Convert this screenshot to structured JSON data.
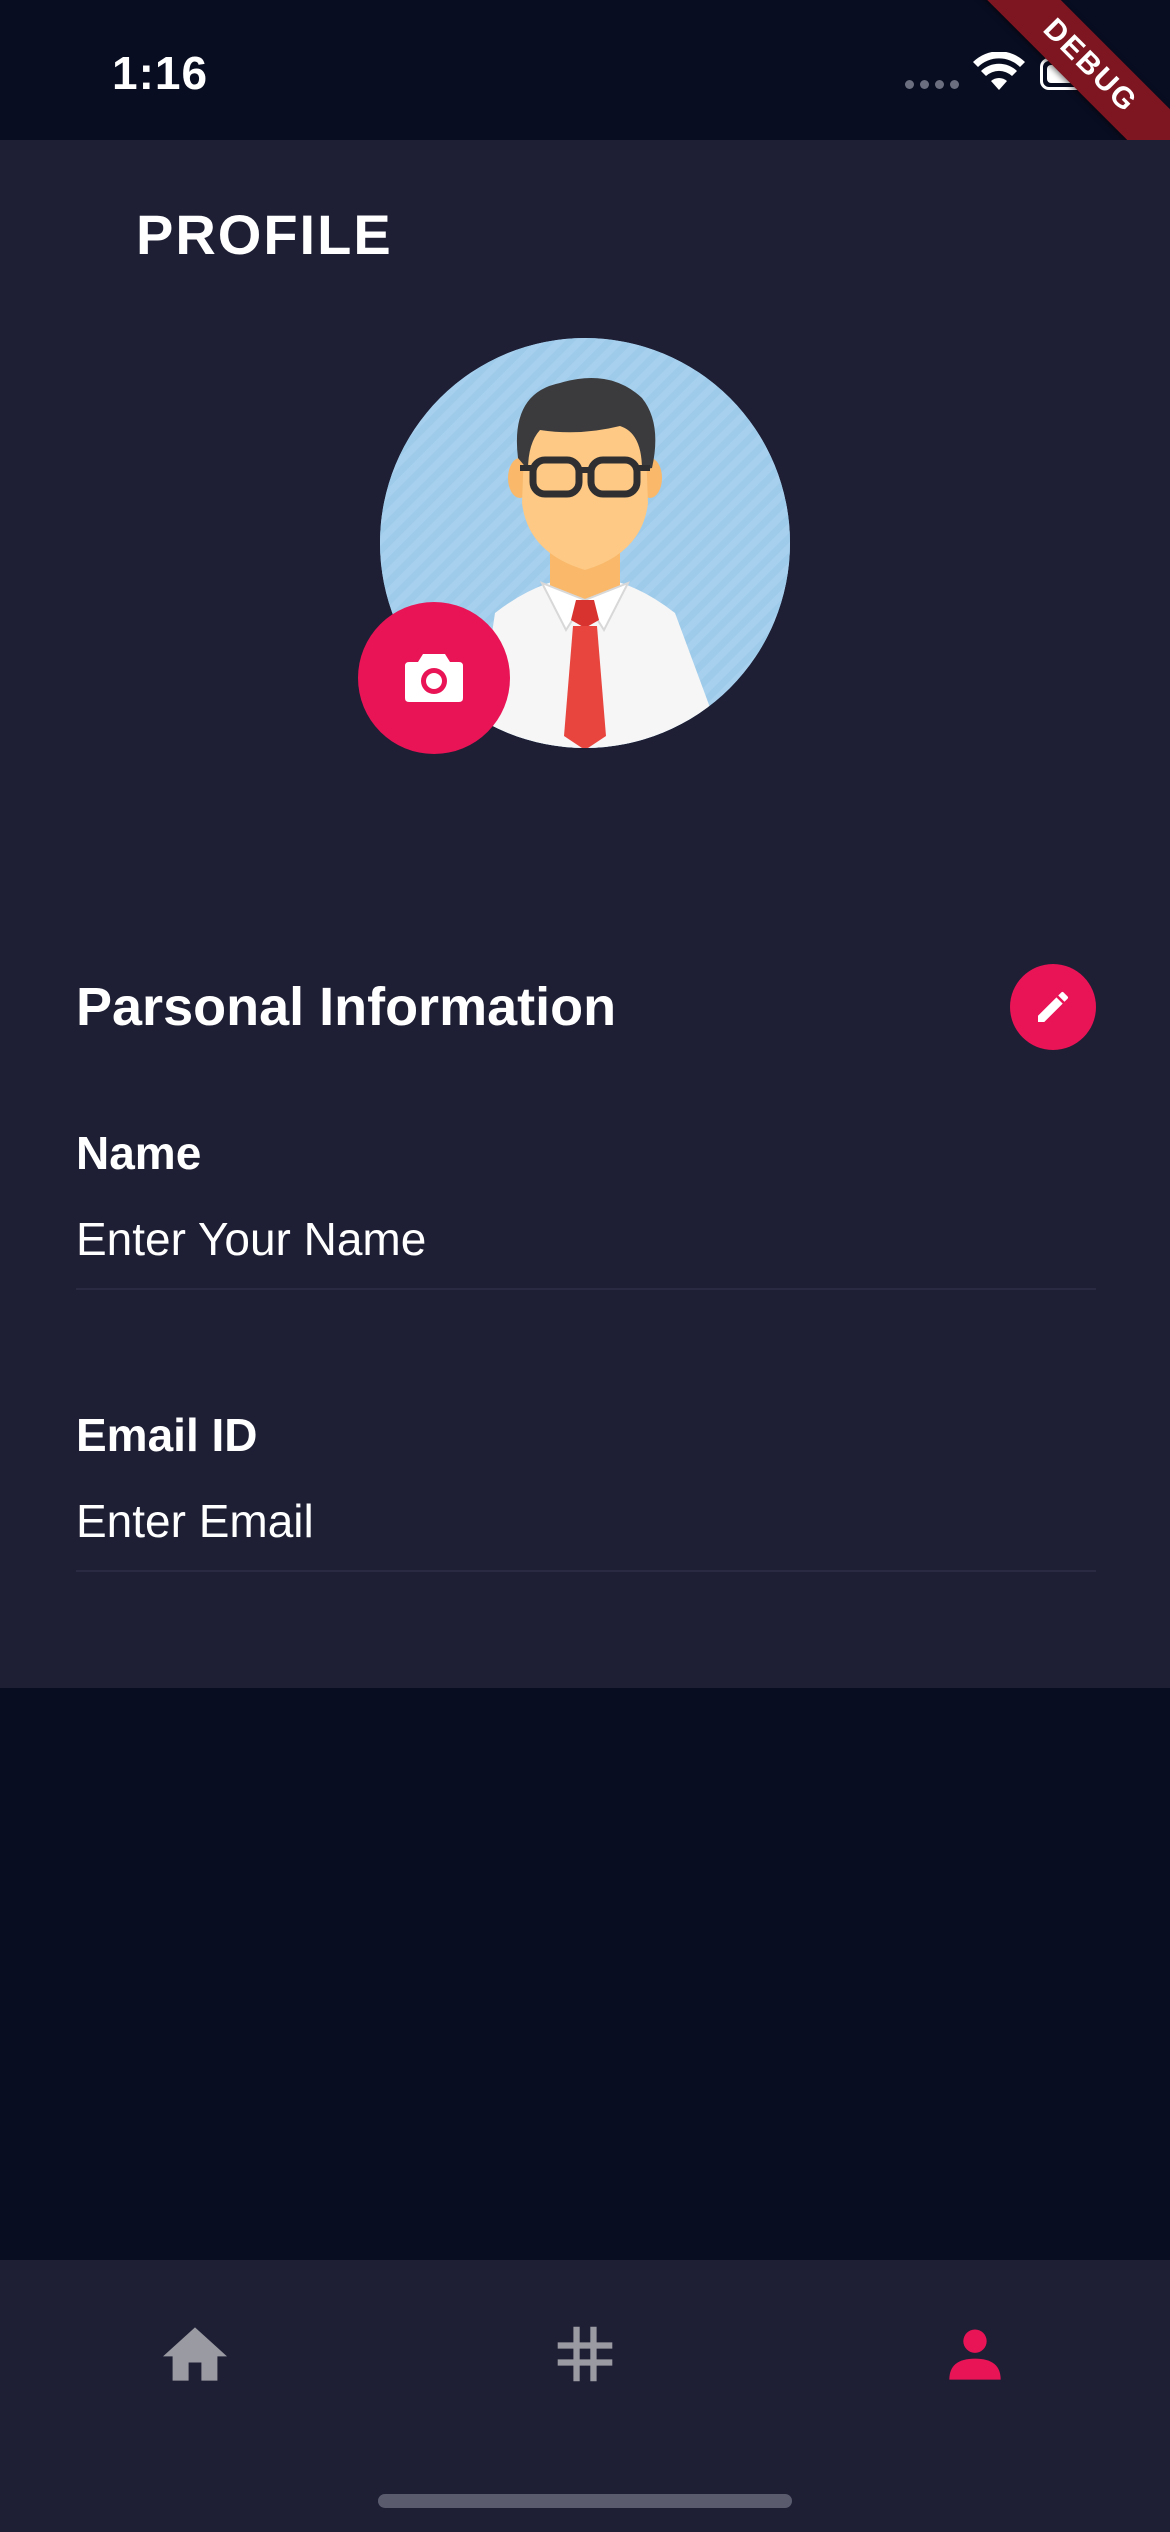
{
  "status_bar": {
    "time": "1:16",
    "debug_label": "DEBUG"
  },
  "header": {
    "title": "PROFILE"
  },
  "avatar": {
    "camera_icon": "camera-icon"
  },
  "personal_info": {
    "title": "Parsonal Information",
    "edit_icon": "pencil-icon",
    "fields": [
      {
        "label": "Name",
        "placeholder": "Enter Your Name",
        "value": ""
      },
      {
        "label": "Email ID",
        "placeholder": "Enter Email",
        "value": ""
      }
    ]
  },
  "bottom_nav": {
    "items": [
      {
        "icon": "home-icon",
        "active": false
      },
      {
        "icon": "hashtag-icon",
        "active": false
      },
      {
        "icon": "person-icon",
        "active": true
      }
    ]
  },
  "colors": {
    "accent": "#e91456",
    "card_background": "#1e1f35",
    "page_background": "#090d21",
    "inactive_icon": "#9a9aa2"
  }
}
